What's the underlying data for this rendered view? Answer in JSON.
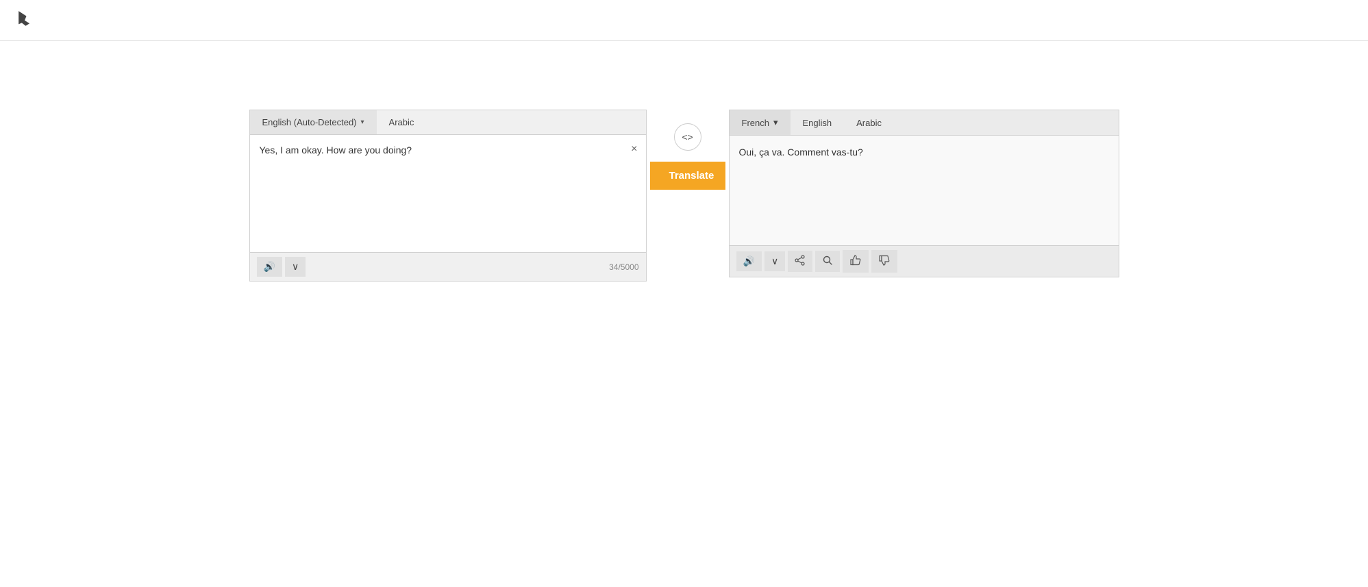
{
  "header": {
    "logo_alt": "Bing"
  },
  "source": {
    "lang_tabs": [
      {
        "label": "English (Auto-Detected)",
        "has_dropdown": true,
        "active": true
      },
      {
        "label": "Arabic",
        "has_dropdown": false,
        "active": false
      }
    ],
    "text": "Yes, I am okay. How are you doing?",
    "char_count": "34/5000",
    "clear_label": "×",
    "speak_label": "🔊",
    "chevron_down": "∨"
  },
  "middle": {
    "swap_icon": "◁▷",
    "translate_label": "Translate"
  },
  "target": {
    "lang_tabs": [
      {
        "label": "French",
        "has_dropdown": true,
        "active": true
      },
      {
        "label": "English",
        "has_dropdown": false,
        "active": false
      },
      {
        "label": "Arabic",
        "has_dropdown": false,
        "active": false
      }
    ],
    "translated_text": "Oui, ça va. Comment vas-tu?",
    "speak_label": "🔊",
    "chevron_down": "∨",
    "share_icon": "share",
    "search_icon": "search",
    "thumbup_icon": "👍",
    "thumbdown_icon": "👎"
  },
  "colors": {
    "translate_bg": "#f5a623",
    "header_border": "#e0e0e0",
    "panel_border": "#d0d0d0",
    "tab_bg": "#f0f0f0",
    "target_tab_bg": "#ebebeb"
  }
}
